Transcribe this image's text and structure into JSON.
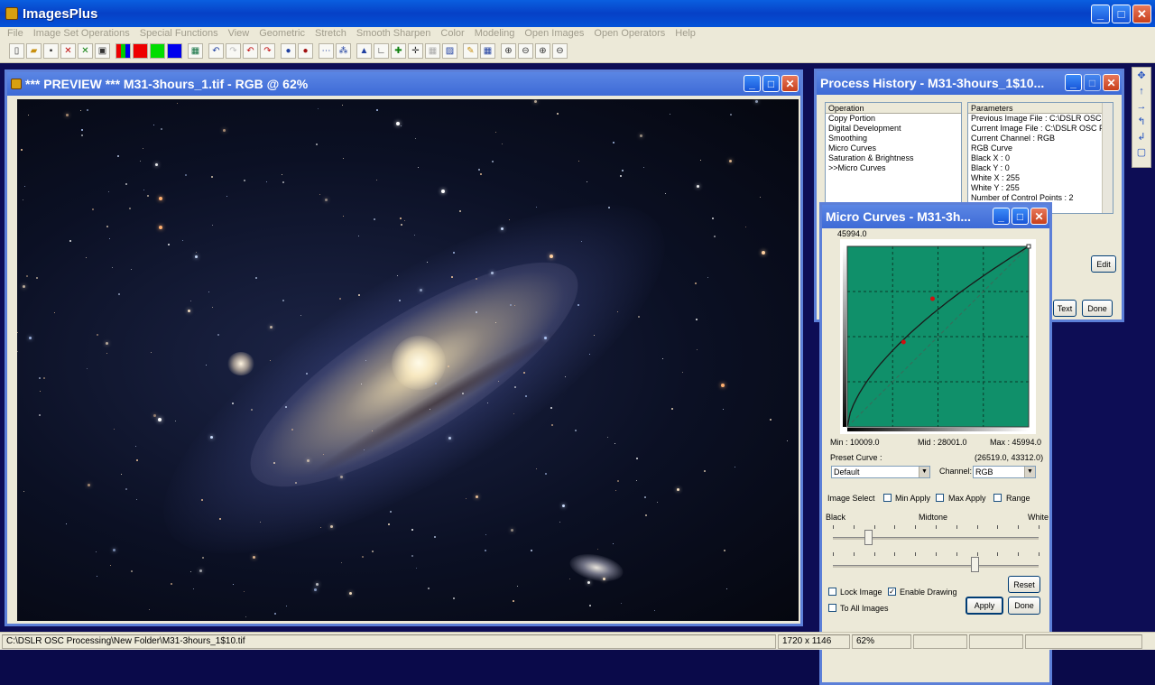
{
  "app": {
    "title": "ImagesPlus"
  },
  "menu": [
    "File",
    "Image Set Operations",
    "Special Functions",
    "View",
    "Geometric",
    "Stretch",
    "Smooth Sharpen",
    "Color",
    "Modeling",
    "Open Images",
    "Open Operators",
    "Help"
  ],
  "preview": {
    "title": "*** PREVIEW *** M31-3hours_1.tif - RGB @ 62%"
  },
  "history": {
    "title": "Process History - M31-3hours_1$10...",
    "operation_header": "Operation",
    "operations": [
      "Copy Portion",
      "Digital Development",
      "Smoothing",
      "Micro Curves",
      "Saturation & Brightness",
      ">>Micro Curves"
    ],
    "parameters_header": "Parameters",
    "parameters": [
      "Previous Image File : C:\\DSLR OSC Pr",
      "Current Image File : C:\\DSLR OSC Pr",
      "Current Channel : RGB",
      "RGB Curve",
      "Black X : 0",
      "Black Y : 0",
      "White X : 255",
      "White Y : 255",
      "Number of Control Points : 2"
    ],
    "edit_label": "Edit",
    "text_label": "Text",
    "done_label": "Done"
  },
  "curves": {
    "title": "Micro Curves - M31-3h...",
    "top_value": "45994.0",
    "min_label": "Min :  10009.0",
    "mid_label": "Mid :  28001.0",
    "max_label": "Max :  45994.0",
    "preset_label": "Preset Curve :",
    "coords": "(26519.0, 43312.0)",
    "preset_value": "Default",
    "channel_label": "Channel:",
    "channel_value": "RGB",
    "image_select_label": "Image Select",
    "min_apply_label": "Min Apply",
    "max_apply_label": "Max Apply",
    "range_label": "Range",
    "black_label": "Black",
    "midtone_label": "Midtone",
    "white_label": "White",
    "reset_label": "Reset",
    "lock_image_label": "Lock Image",
    "enable_drawing_label": "Enable Drawing",
    "to_all_images_label": "To All Images",
    "apply_label": "Apply",
    "done_label": "Done",
    "slider1_level": 0.17,
    "slider2_level": 0.69,
    "graph_color": "#10906a",
    "control_point_color": "#d01010"
  },
  "status": {
    "path": "C:\\DSLR OSC Processing\\New Folder\\M31-3hours_1$10.tif",
    "dimensions": "1720 x 1146",
    "zoom": "62%"
  }
}
